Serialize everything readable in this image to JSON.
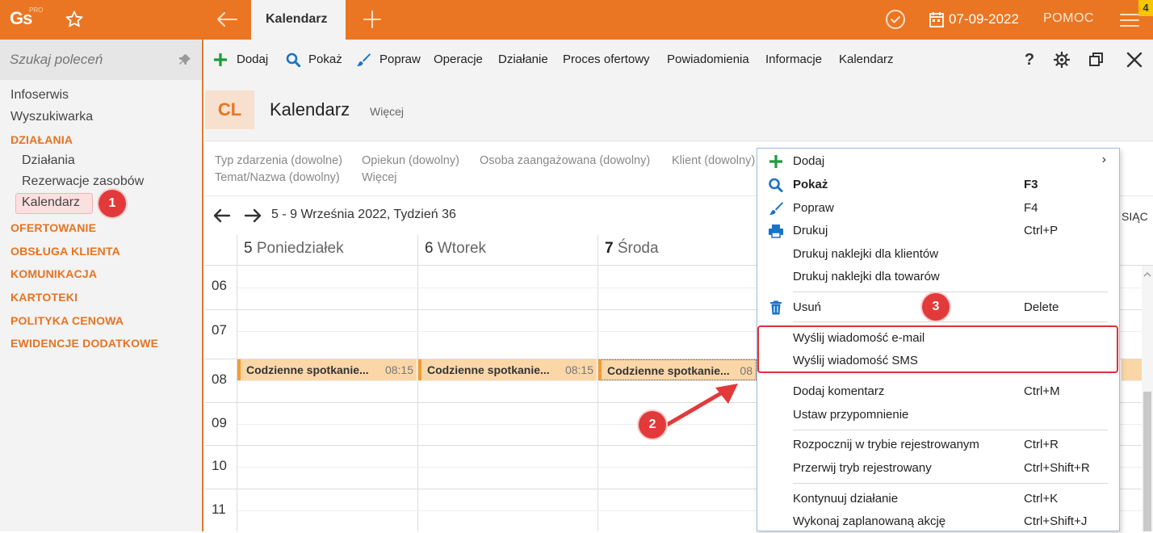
{
  "app": {
    "logo_text": "Gs",
    "logo_sub": "PRO",
    "tab_label": "Kalendarz",
    "date": "07-09-2022",
    "help_label": "POMOC",
    "notification_count": "4"
  },
  "sidebar": {
    "search_placeholder": "Szukaj poleceń",
    "items": [
      {
        "label": "Infoserwis"
      },
      {
        "label": "Wyszukiwarka"
      }
    ],
    "sections": [
      {
        "label": "DZIAŁANIA"
      },
      {
        "label": "OFERTOWANIE"
      },
      {
        "label": "OBSŁUGA KLIENTA"
      },
      {
        "label": "KOMUNIKACJA"
      },
      {
        "label": "KARTOTEKI"
      },
      {
        "label": "POLITYKA CENOWA"
      },
      {
        "label": "EWIDENCJE DODATKOWE"
      }
    ],
    "sub_items": [
      {
        "label": "Działania"
      },
      {
        "label": "Rezerwacje zasobów"
      },
      {
        "label": "Kalendarz"
      }
    ]
  },
  "toolbar": {
    "items": [
      {
        "label": "Dodaj",
        "icon": "plus-icon"
      },
      {
        "label": "Pokaż",
        "icon": "search-icon"
      },
      {
        "label": "Popraw",
        "icon": "brush-icon"
      },
      {
        "label": "Operacje"
      },
      {
        "label": "Działanie"
      },
      {
        "label": "Proces ofertowy"
      },
      {
        "label": "Powiadomienia"
      },
      {
        "label": "Informacje"
      },
      {
        "label": "Kalendarz"
      }
    ],
    "help_glyph": "?"
  },
  "header": {
    "badge": "CL",
    "title": "Kalendarz",
    "more": "Więcej"
  },
  "filters": {
    "row1": [
      "Typ zdarzenia (dowolne)",
      "Opiekun (dowolny)",
      "Osoba zaangażowana (dowolny)",
      "Klient (dowolny)"
    ],
    "row2": [
      "Temat/Nazwa (dowolny)",
      "Więcej"
    ]
  },
  "calendar": {
    "range": "5 - 9 Września 2022, Tydzień 36",
    "view_partial": "SIĄC",
    "days": [
      {
        "num": "5",
        "name": "Poniedziałek"
      },
      {
        "num": "6",
        "name": "Wtorek"
      },
      {
        "num": "7",
        "name": "Środa"
      }
    ],
    "hours": [
      "06",
      "07",
      "08",
      "09",
      "10",
      "11"
    ],
    "events": [
      {
        "title": "Codzienne spotkanie...",
        "time": "08:15"
      },
      {
        "title": "Codzienne spotkanie...",
        "time": "08:15"
      },
      {
        "title": "Codzienne spotkanie...",
        "time": "08"
      }
    ]
  },
  "context_menu": {
    "items": [
      {
        "label": "Dodaj",
        "key": "",
        "icon": "plus-icon",
        "submenu": "›"
      },
      {
        "label": "Pokaż",
        "key": "F3",
        "icon": "search-icon"
      },
      {
        "label": "Popraw",
        "key": "F4",
        "icon": "brush-icon"
      },
      {
        "label": "Drukuj",
        "key": "Ctrl+P",
        "icon": "printer-icon"
      },
      {
        "label": "Drukuj naklejki dla klientów",
        "key": ""
      },
      {
        "label": "Drukuj naklejki dla towarów",
        "key": ""
      },
      {
        "label": "Usuń",
        "key": "Delete",
        "icon": "trash-icon"
      },
      {
        "label": "Wyślij wiadomość e-mail",
        "key": ""
      },
      {
        "label": "Wyślij wiadomość SMS",
        "key": ""
      },
      {
        "label": "Dodaj komentarz",
        "key": "Ctrl+M"
      },
      {
        "label": "Ustaw przypomnienie",
        "key": ""
      },
      {
        "label": "Rozpocznij w trybie rejestrowanym",
        "key": "Ctrl+R"
      },
      {
        "label": "Przerwij tryb rejestrowany",
        "key": "Ctrl+Shift+R"
      },
      {
        "label": "Kontynuuj działanie",
        "key": "Ctrl+K"
      },
      {
        "label": "Wykonaj zaplanowaną akcję",
        "key": "Ctrl+Shift+J"
      }
    ]
  },
  "annotations": {
    "m1": "1",
    "m2": "2",
    "m3": "3"
  },
  "colors": {
    "accent": "#ea7623",
    "marker": "#e23a3a",
    "event_bg": "#fbd7a8"
  }
}
